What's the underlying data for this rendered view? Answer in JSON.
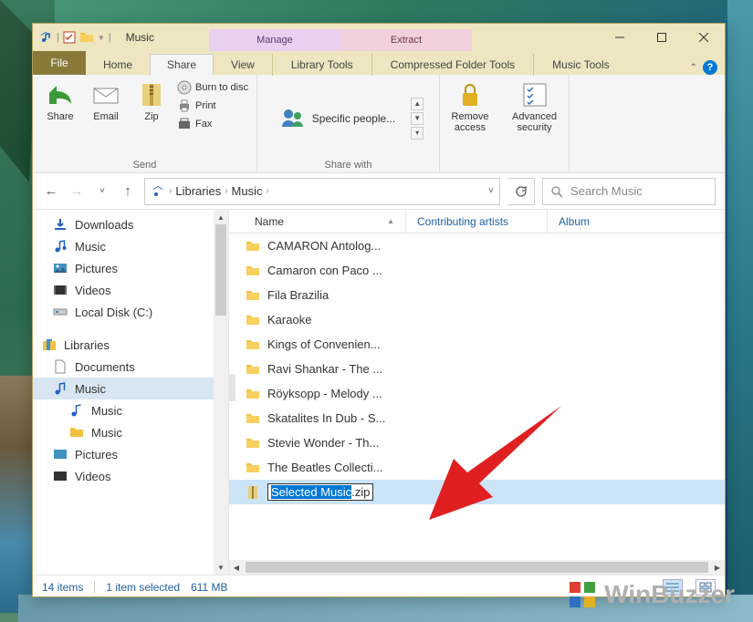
{
  "titlebar": {
    "title": "Music"
  },
  "context_tabs": {
    "manage": "Manage",
    "extract": "Extract"
  },
  "ribbon_tabs": {
    "file": "File",
    "home": "Home",
    "share": "Share",
    "view": "View",
    "library": "Library Tools",
    "compressed": "Compressed Folder Tools",
    "music": "Music Tools"
  },
  "ribbon": {
    "send": {
      "label": "Send",
      "share": "Share",
      "email": "Email",
      "zip": "Zip",
      "burn": "Burn to disc",
      "print": "Print",
      "fax": "Fax"
    },
    "share_with": {
      "label": "Share with",
      "specific": "Specific people..."
    },
    "remove": "Remove\naccess",
    "advanced": "Advanced\nsecurity"
  },
  "breadcrumb": {
    "root": "Libraries",
    "current": "Music"
  },
  "search": {
    "placeholder": "Search Music"
  },
  "nav": {
    "downloads": "Downloads",
    "music": "Music",
    "pictures": "Pictures",
    "videos": "Videos",
    "localc": "Local Disk (C:)",
    "libraries": "Libraries",
    "documents": "Documents",
    "lib_music": "Music",
    "lib_music_sub1": "Music",
    "lib_music_sub2": "Music",
    "lib_pictures": "Pictures",
    "lib_videos": "Videos"
  },
  "columns": {
    "name": "Name",
    "artists": "Contributing artists",
    "album": "Album"
  },
  "files": [
    "CAMARON Antolog...",
    "Camaron con Paco ...",
    "Fila Brazilia",
    "Karaoke",
    "Kings of Convenien...",
    "Ravi Shankar - The ...",
    "Röyksopp - Melody ...",
    "Skatalites In Dub - S...",
    "Stevie Wonder - Th...",
    "The Beatles Collecti..."
  ],
  "rename": {
    "selected": "Selected Music",
    "ext": ".zip"
  },
  "status": {
    "count": "14 items",
    "selected": "1 item selected",
    "size": "611 MB"
  },
  "watermark": "WinBuzzer"
}
